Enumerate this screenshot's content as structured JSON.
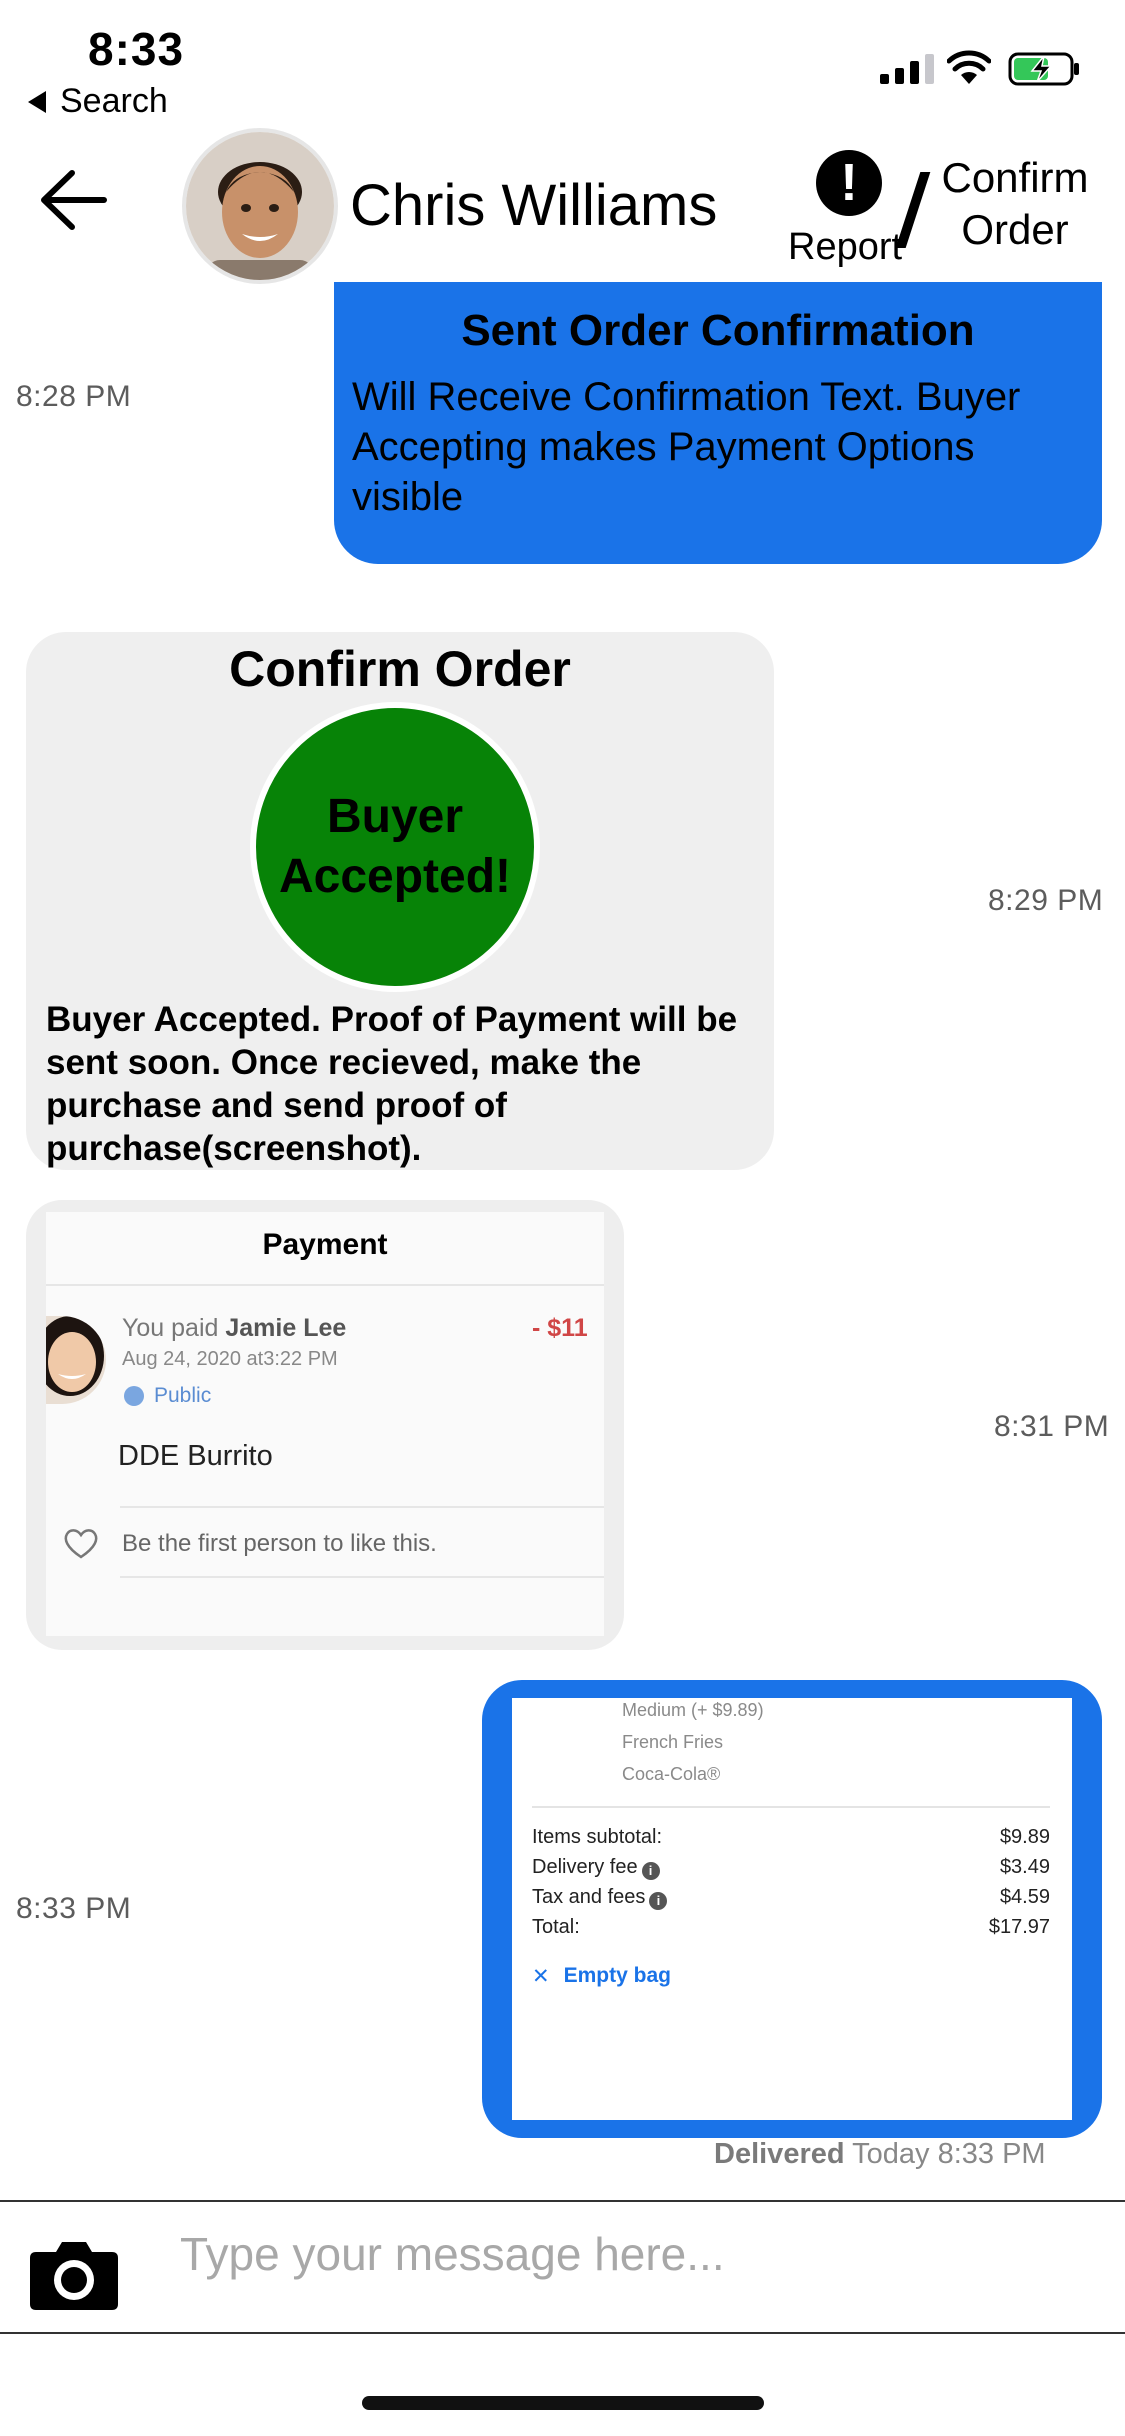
{
  "status_bar": {
    "time": "8:33",
    "back_label": "Search"
  },
  "header": {
    "contact_name": "Chris Williams",
    "report_label": "Report",
    "report_icon_glyph": "!",
    "confirm_order_line1": "Confirm",
    "confirm_order_line2": "Order"
  },
  "messages": {
    "sent_confirmation": {
      "time": "8:28 PM",
      "title": "Sent Order Confirmation",
      "body": "Will Receive Confirmation Text. Buyer Accepting makes Payment Options visible",
      "color": "#1a73e8"
    },
    "confirm_order": {
      "time": "8:29 PM",
      "title": "Confirm Order",
      "badge_line1": "Buyer",
      "badge_line2": "Accepted!",
      "badge_color": "#078307",
      "body": "Buyer Accepted. Proof of Payment will be sent soon. Once recieved, make the purchase and send proof of purchase(screenshot)."
    },
    "payment_screenshot": {
      "time": "8:31 PM",
      "title": "Payment",
      "paid_prefix": "You paid ",
      "payee": "Jamie Lee",
      "amount": "- $11",
      "date": "Aug 24, 2020 at3:22 PM",
      "visibility": "Public",
      "note": "DDE Burrito",
      "like_prompt": "Be the first person to like this."
    },
    "receipt_screenshot": {
      "time": "8:33 PM",
      "items": [
        "Medium (+ $9.89)",
        "French Fries",
        "Coca-Cola®"
      ],
      "subtotal_label": "Items subtotal:",
      "subtotal_value": "$9.89",
      "delivery_label": "Delivery fee",
      "delivery_value": "$3.49",
      "tax_label": "Tax and fees",
      "tax_value": "$4.59",
      "total_label": "Total:",
      "total_value": "$17.97",
      "empty_bag_icon": "✕",
      "empty_bag_label": "Empty bag"
    },
    "delivered_status": "Delivered",
    "delivered_time": "Today 8:33 PM"
  },
  "composer": {
    "placeholder": "Type your message here..."
  }
}
